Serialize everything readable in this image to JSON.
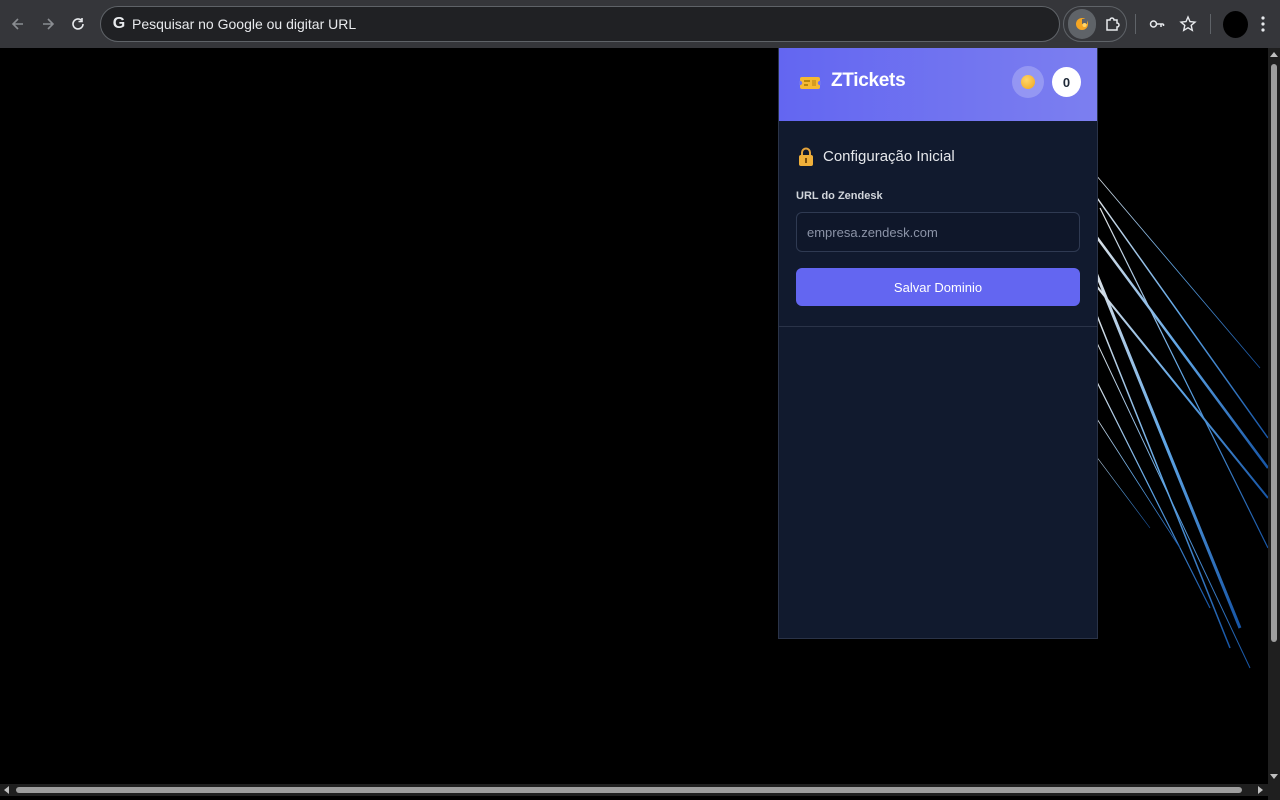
{
  "browser": {
    "omnibox_placeholder": "Pesquisar no Google ou digitar URL",
    "google_glyph": "G"
  },
  "popup": {
    "brand_title": "ZTickets",
    "ticket_count": "0",
    "section_title": "Configuração Inicial",
    "url_label": "URL do Zendesk",
    "url_placeholder": "empresa.zendesk.com",
    "url_value": "",
    "save_label": "Salvar Dominio"
  },
  "colors": {
    "header_gradient_start": "#6366f1",
    "header_gradient_end": "#7c7ff0",
    "popup_bg": "#111a2e",
    "button_bg": "#6366f1",
    "toolbar_bg": "#35363a"
  },
  "icons": {
    "back": "arrow-left-icon",
    "forward": "arrow-right-icon",
    "reload": "reload-icon",
    "extension_active": "ztickets-extension-icon",
    "extensions": "puzzle-icon",
    "passwords": "key-icon",
    "bookmark": "star-icon",
    "menu": "kebab-menu-icon",
    "brand": "ticket-icon",
    "coin": "coin-icon",
    "section": "lock-icon"
  }
}
